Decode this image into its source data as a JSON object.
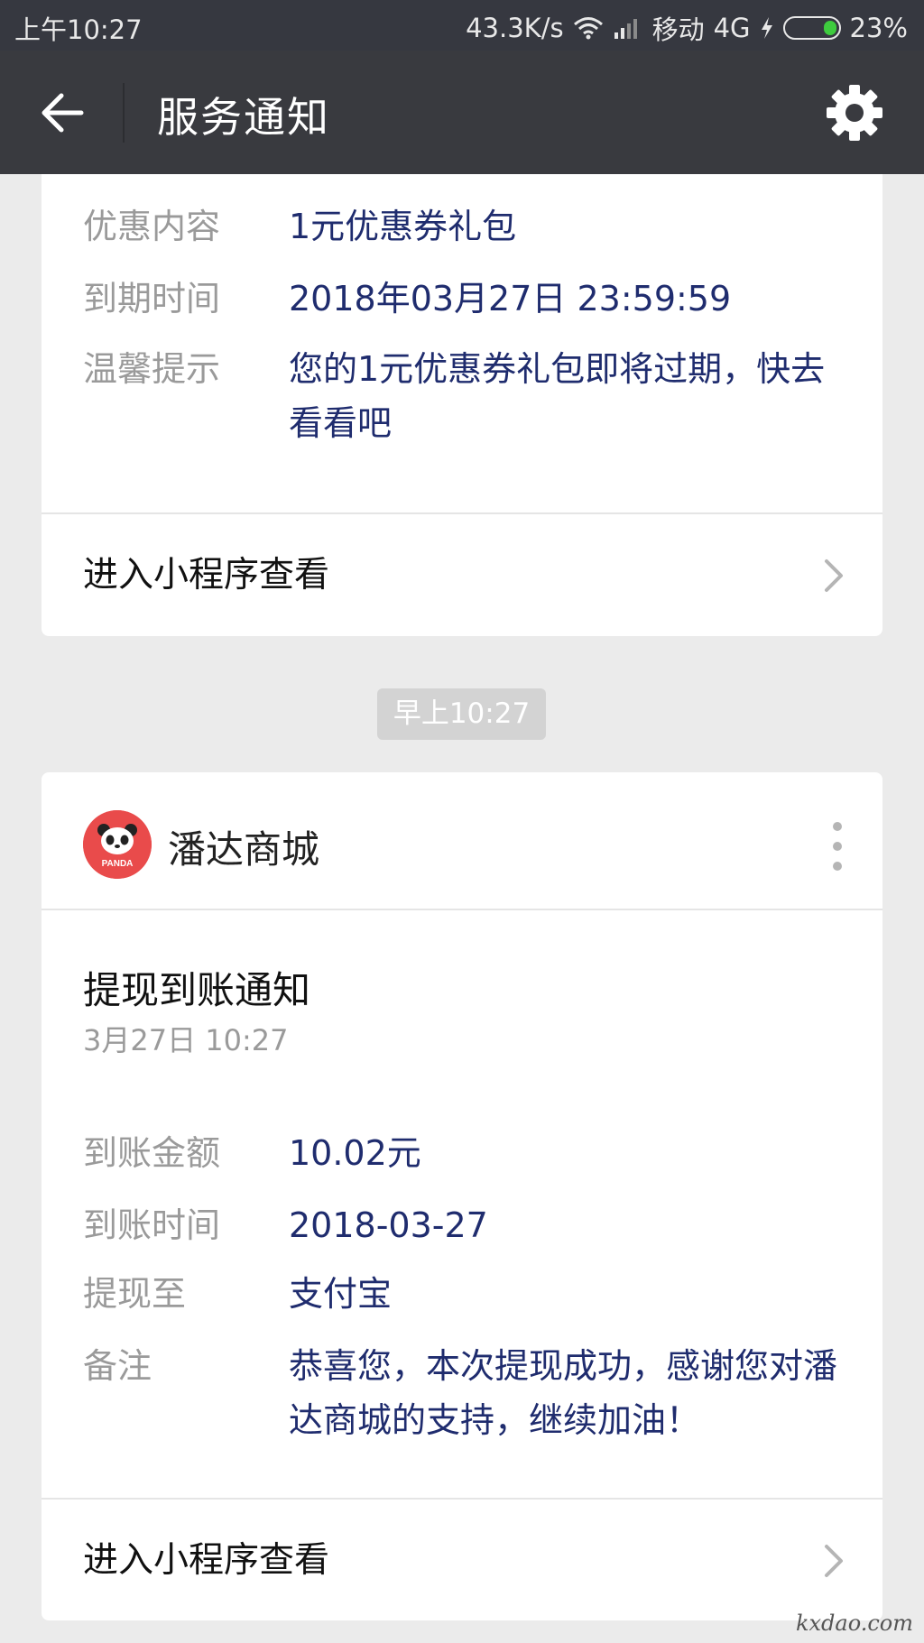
{
  "status_bar": {
    "time": "上午10:27",
    "net_speed": "43.3K/s",
    "carrier": "移动",
    "network": "4G",
    "battery": "23%"
  },
  "title_bar": {
    "title": "服务通知"
  },
  "card1": {
    "fields": [
      {
        "label": "优惠内容",
        "value": "1元优惠券礼包"
      },
      {
        "label": "到期时间",
        "value": "2018年03月27日 23:59:59"
      },
      {
        "label": "温馨提示",
        "value": "您的1元优惠券礼包即将过期，快去看看吧"
      }
    ],
    "enter_label": "进入小程序查看"
  },
  "time_chip": "早上10:27",
  "card2": {
    "shop_name": "潘达商城",
    "avatar_text": "PANDA",
    "notice_title": "提现到账通知",
    "notice_time": "3月27日  10:27",
    "fields": [
      {
        "label": "到账金额",
        "value": "10.02元"
      },
      {
        "label": "到账时间",
        "value": "2018-03-27"
      },
      {
        "label": "提现至",
        "value": "支付宝"
      },
      {
        "label": "备注",
        "value": "恭喜您，本次提现成功，感谢您对潘达商城的支持，继续加油！"
      }
    ],
    "enter_label": "进入小程序查看"
  },
  "watermark": "kxdao.com",
  "colors": {
    "status_bar_bg": "#363840",
    "title_bar_bg": "#393a3f",
    "page_bg": "#ebebeb",
    "value_text": "#1f2c6e",
    "label_text": "#9a9a9a",
    "avatar_red": "#e94b4b"
  }
}
